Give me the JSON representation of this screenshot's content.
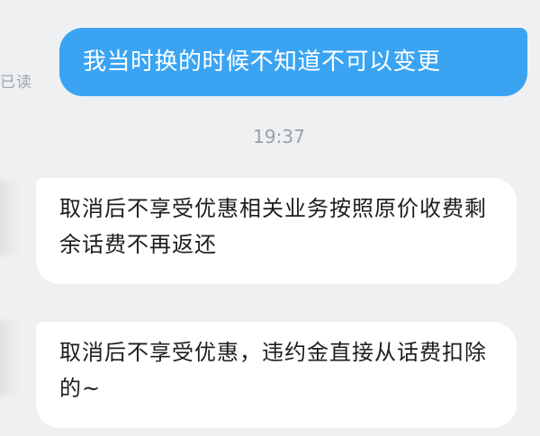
{
  "conversation": {
    "outgoing": {
      "read_status": "已读",
      "text": "我当时换的时候不知道不可以变更"
    },
    "timestamp": "19:37",
    "incoming": [
      {
        "text": "取消后不享受优惠相关业务按照原价收费剩余话费不再返还"
      },
      {
        "text": "取消后不享受优惠，违约金直接从话费扣除的~"
      }
    ]
  },
  "colors": {
    "background": "#eef0f2",
    "outgoing_bubble": "#3aa4f3",
    "incoming_bubble": "#ffffff"
  }
}
